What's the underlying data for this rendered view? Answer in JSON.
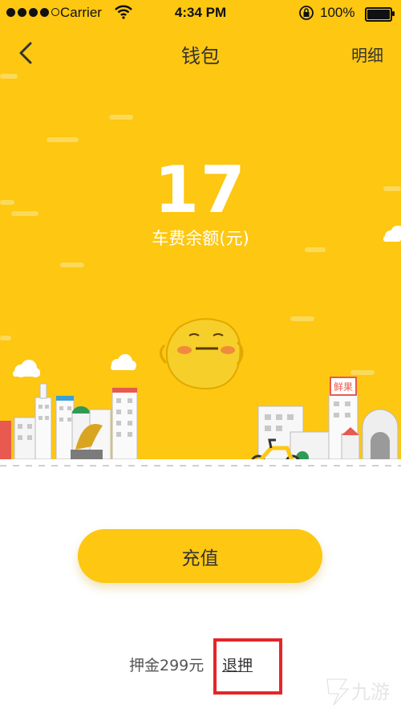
{
  "status_bar": {
    "carrier": "Carrier",
    "time": "4:34 PM",
    "battery": "100%"
  },
  "nav": {
    "title": "钱包",
    "detail_label": "明细"
  },
  "wallet": {
    "balance": "17",
    "balance_label": "车费余额(元)"
  },
  "scenery": {
    "shop_sign": "鲜果"
  },
  "actions": {
    "recharge_label": "充值",
    "deposit_text": "押金299元",
    "refund_label": "退押"
  },
  "watermark": {
    "text": "九游"
  },
  "colors": {
    "brand_yellow": "#fdc712",
    "highlight_red": "#e4252a"
  }
}
